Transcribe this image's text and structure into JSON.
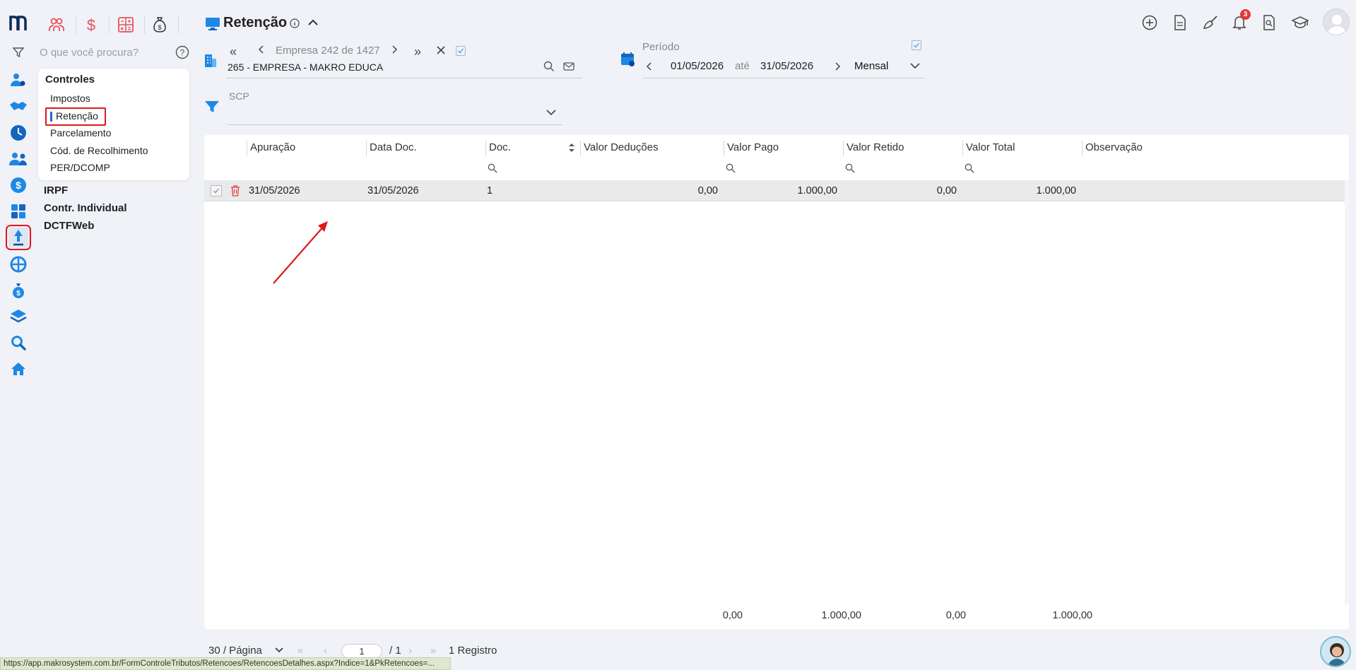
{
  "nav": {
    "search_placeholder": "O que você procura?",
    "menu_title": "Controles",
    "menu_items": [
      "Impostos",
      "Retenção",
      "Parcelamento",
      "Cód. de Recolhimento",
      "PER/DCOMP"
    ],
    "groups": [
      "IRPF",
      "Contr. Individual",
      "DCTFWeb"
    ]
  },
  "header": {
    "title": "Retenção",
    "notification_count": "3"
  },
  "empresa": {
    "label": "Empresa",
    "index": "242",
    "of": "de",
    "total": "1427",
    "name": "265 - EMPRESA - MAKRO EDUCA"
  },
  "periodo": {
    "label": "Período",
    "start": "01/05/2026",
    "separator": "até",
    "end": "31/05/2026",
    "mode": "Mensal"
  },
  "scp": {
    "label": "SCP"
  },
  "grid": {
    "columns": [
      "Apuração",
      "Data Doc.",
      "Doc.",
      "Valor Deduções",
      "Valor Pago",
      "Valor Retido",
      "Valor Total",
      "Observação"
    ],
    "rows": [
      {
        "apuracao": "31/05/2026",
        "data_doc": "31/05/2026",
        "doc": "1",
        "valor_deducoes": "0,00",
        "valor_pago": "1.000,00",
        "valor_retido": "0,00",
        "valor_total": "1.000,00",
        "observacao": ""
      }
    ],
    "totals": {
      "valor_deducoes": "0,00",
      "valor_pago": "1.000,00",
      "valor_retido": "0,00",
      "valor_total": "1.000,00"
    }
  },
  "pager": {
    "per_page": "30 / Página",
    "page": "1",
    "pages": "/ 1",
    "records": "1 Registro"
  },
  "status_url": "https://app.makrosystem.com.br/FormControleTributos/Retencoes/RetencoesDetalhes.aspx?Indice=1&PkRetencoes=..."
}
